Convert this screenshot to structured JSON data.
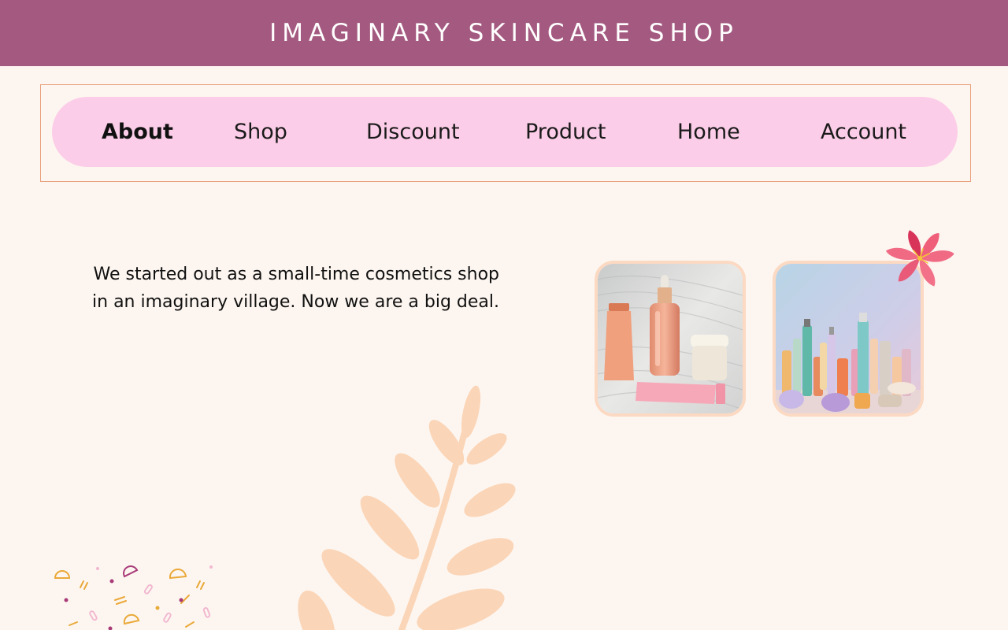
{
  "header": {
    "title": "IMAGINARY SKINCARE SHOP"
  },
  "nav": {
    "items": [
      {
        "label": "About",
        "active": true
      },
      {
        "label": "Shop",
        "active": false
      },
      {
        "label": "Discount",
        "active": false
      },
      {
        "label": "Product",
        "active": false
      },
      {
        "label": "Home",
        "active": false
      },
      {
        "label": "Account",
        "active": false
      }
    ]
  },
  "main": {
    "intro_text": "We started out as a  small-time cosmetics shop in an imaginary village. Now we are a big deal.",
    "photos": [
      {
        "name": "skincare-products-photo"
      },
      {
        "name": "cosmetic-bottles-photo"
      }
    ]
  },
  "decorations": {
    "icons": [
      "lily-flower-icon",
      "leaf-branch-icon",
      "confetti-pattern-icon"
    ]
  },
  "colors": {
    "header_bg": "#a45a80",
    "nav_pill_bg": "#fccde8",
    "nav_frame_border": "#e9a07c",
    "page_bg": "#fdf6f0",
    "leaf": "#fbd5b7",
    "flower": "#ef5f7a"
  }
}
